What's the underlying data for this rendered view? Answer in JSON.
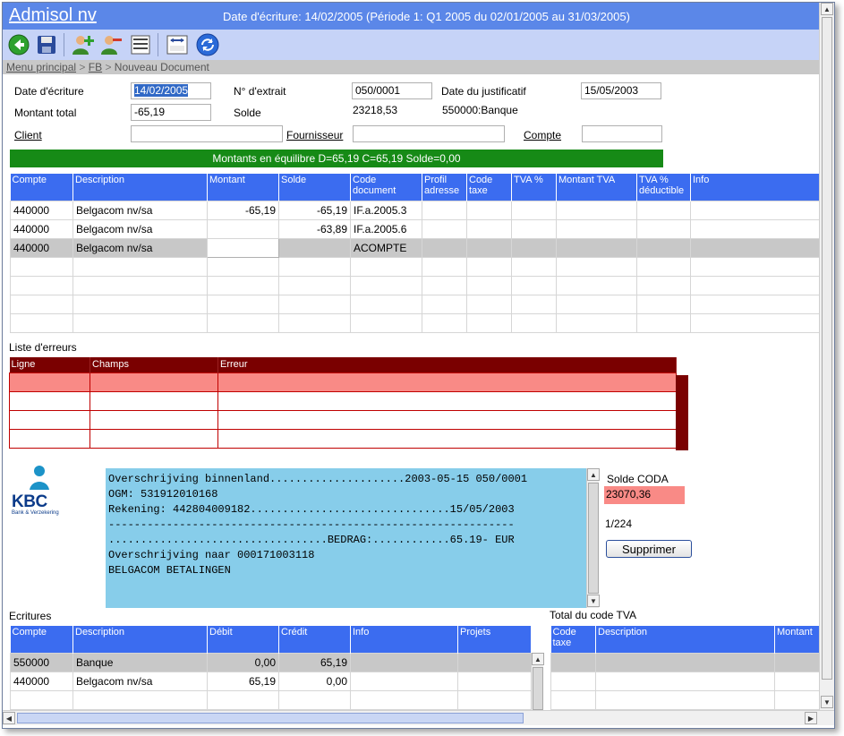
{
  "header": {
    "app_title": "Admisol nv",
    "period_info": "Date d'écriture: 14/02/2005 (Période 1: Q1 2005 du 02/01/2005 au 31/03/2005)"
  },
  "toolbar": {
    "icons": [
      "back-icon",
      "save-icon",
      "add-user-icon",
      "remove-user-icon",
      "list-icon",
      "calculator-icon",
      "refresh-icon"
    ]
  },
  "breadcrumb": {
    "items": [
      "Menu principal",
      "FB",
      "Nouveau Document"
    ],
    "separator": ">"
  },
  "form": {
    "date_ecriture_label": "Date d'écriture",
    "date_ecriture_value": "14/02/2005",
    "extrait_label": "N° d'extrait",
    "extrait_value": "050/0001",
    "date_justif_label": "Date du justificatif",
    "date_justif_value": "15/05/2003",
    "montant_label": "Montant total",
    "montant_value": "-65,19",
    "solde_label": "Solde",
    "solde_value": "23218,53",
    "bank_account": "550000:Banque",
    "client_label": "Client",
    "client_value": "",
    "fournisseur_label": "Fournisseur",
    "fournisseur_value": "",
    "compte_label": "Compte",
    "compte_value": ""
  },
  "balance_message": "Montants en équilibre D=65,19 C=65,19 Solde=0,00",
  "lines_grid": {
    "headers": [
      "Compte",
      "Description",
      "Montant",
      "Solde",
      "Code document",
      "Profil adresse",
      "Code taxe",
      "TVA %",
      "Montant TVA",
      "TVA % déductible",
      "Info"
    ],
    "rows": [
      [
        "440000",
        "Belgacom nv/sa",
        "-65,19",
        "-65,19",
        "IF.a.2005.3",
        "",
        "",
        "",
        "",
        "",
        ""
      ],
      [
        "440000",
        "Belgacom nv/sa",
        "",
        "-63,89",
        "IF.a.2005.6",
        "",
        "",
        "",
        "",
        "",
        ""
      ],
      [
        "440000",
        "Belgacom nv/sa",
        "",
        "",
        "ACOMPTE",
        "",
        "",
        "",
        "",
        "",
        ""
      ]
    ]
  },
  "errors": {
    "title": "Liste d'erreurs",
    "headers": [
      "Ligne",
      "Champs",
      "Erreur"
    ]
  },
  "coda": {
    "bank_name": "KBC",
    "bank_tagline": "Bank & Verzekering",
    "text": "Overschrijving binnenland.....................2003-05-15 050/0001\nOGM: 531912010168\nRekening: 442804009182...............................15/05/2003\n---------------------------------------------------------------\n..................................BEDRAG:............65.19- EUR\nOverschrijving naar 000171003118\nBELGACOM BETALINGEN",
    "solde_label": "Solde CODA",
    "solde_value": "23070,36",
    "counter": "1/224",
    "delete_button": "Supprimer"
  },
  "ecritures": {
    "title": "Ecritures",
    "headers": [
      "Compte",
      "Description",
      "Débit",
      "Crédit",
      "Info",
      "Projets"
    ],
    "rows": [
      [
        "550000",
        "Banque",
        "0,00",
        "65,19",
        "",
        ""
      ],
      [
        "440000",
        "Belgacom nv/sa",
        "65,19",
        "0,00",
        "",
        ""
      ]
    ]
  },
  "tva_totals": {
    "title": "Total du code TVA",
    "headers": [
      "Code taxe",
      "Description",
      "Montant"
    ]
  },
  "colors": {
    "header_blue": "#5b87e8",
    "grid_header_blue": "#3b6cf0",
    "balance_green": "#168a16",
    "error_header": "#7a0000",
    "error_row": "#f98a86",
    "coda_bg": "#87cdea"
  }
}
